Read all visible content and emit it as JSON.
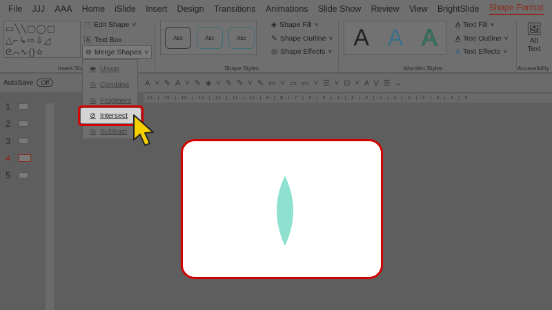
{
  "tabs": [
    "File",
    "JJJ",
    "AAA",
    "Home",
    "iSlide",
    "Insert",
    "Design",
    "Transitions",
    "Animations",
    "Slide Show",
    "Review",
    "View",
    "BrightSlide",
    "Shape Format"
  ],
  "active_tab": "Shape Format",
  "ribbon": {
    "insert_shapes": {
      "label": "Insert Shapes",
      "edit_shape": "Edit Shape",
      "text_box": "Text Box",
      "merge_shapes": "Merge Shapes"
    },
    "shape_styles": {
      "label": "Shape Styles",
      "previews": [
        "Abc",
        "Abc",
        "Abc"
      ],
      "shape_fill": "Shape Fill",
      "shape_outline": "Shape Outline",
      "shape_effects": "Shape Effects"
    },
    "wordart": {
      "label": "WordArt Styles",
      "previews": [
        "A",
        "A",
        "A"
      ],
      "text_fill": "Text Fill",
      "text_outline": "Text Outline",
      "text_effects": "Text Effects"
    },
    "accessibility": {
      "label": "Accessibility",
      "alt_text_1": "Alt",
      "alt_text_2": "Text"
    }
  },
  "qat": {
    "autosave": "AutoSave",
    "toggle": "Off"
  },
  "merge_menu": {
    "items": [
      "Union",
      "Combine",
      "Fragment",
      "Intersect",
      "Subtract"
    ],
    "selected": "Intersect"
  },
  "ruler": "· 16 · | · 15 · | · 14 · | · 13 · | · 12 · | · 11 · | · 10 · | · 9 · | · 8 · | · 7 · | · 6 · | · 5 · | · 4 · | · 3 · | · 2 · | · 1 · | · 0 · | · 1 · | · 2 · | · 3 · | · 4 · | · 5 ·",
  "slides": [
    "1",
    "2",
    "3",
    "4",
    "5"
  ],
  "current_slide": "4",
  "colors": {
    "accent": "#d40000",
    "shape": "#8ee0cf",
    "cursor": "#f5d000"
  }
}
